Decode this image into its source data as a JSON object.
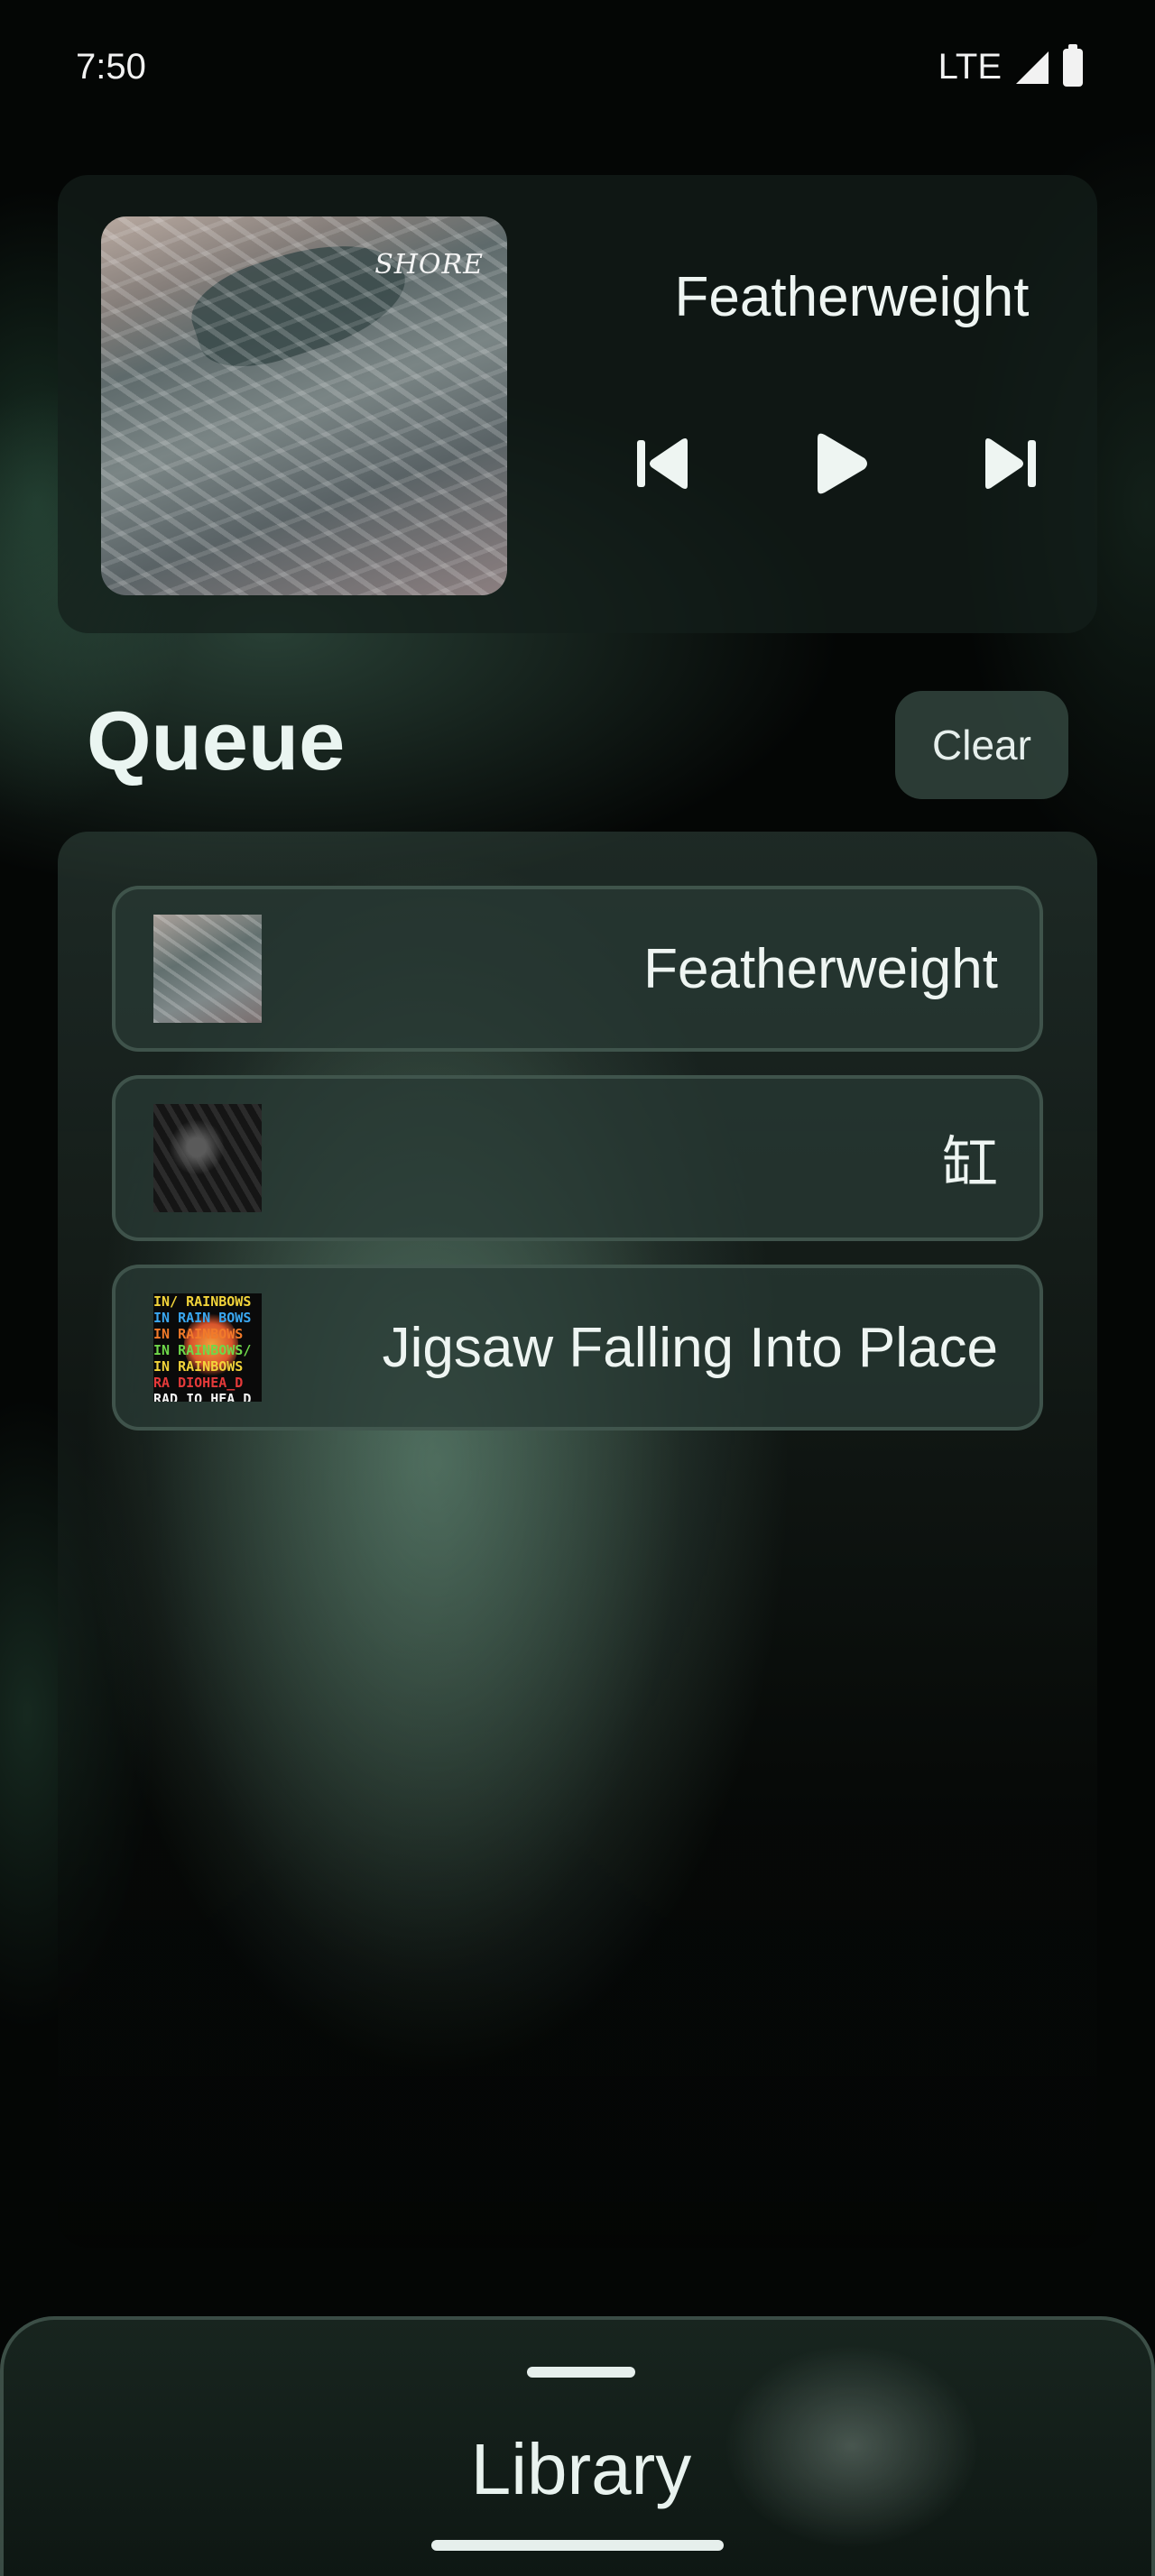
{
  "status_bar": {
    "time": "7:50",
    "network": "LTE"
  },
  "now_playing": {
    "title": "Featherweight",
    "album_art_text": "SHORE",
    "controls": {
      "previous": "skip-previous-icon",
      "play": "play-icon",
      "next": "skip-next-icon"
    }
  },
  "queue": {
    "title": "Queue",
    "clear_label": "Clear",
    "items": [
      {
        "title": "Featherweight",
        "art": "shore"
      },
      {
        "title": "缸",
        "art": "dark"
      },
      {
        "title": "Jigsaw Falling Into Place",
        "art": "rainbows"
      }
    ]
  },
  "rainbows_art_lines": [
    {
      "text": "IN/ RAINBOWS",
      "color": "#f2d43a"
    },
    {
      "text": "IN RAIN BOWS",
      "color": "#3aa8f2"
    },
    {
      "text": "IN RAINBOWS",
      "color": "#f27a2a"
    },
    {
      "text": "IN RAINBOWS/",
      "color": "#6fd84a"
    },
    {
      "text": "IN RAINBOWS",
      "color": "#f2d43a"
    },
    {
      "text": "RA DIOHEA_D",
      "color": "#e63a3a"
    },
    {
      "text": "RAD IO HEA D",
      "color": "#f4f4f4"
    }
  ],
  "library": {
    "label": "Library"
  },
  "colors": {
    "accent": "#e8f2ee",
    "panel": "#1e2d27",
    "background": "#040605"
  }
}
